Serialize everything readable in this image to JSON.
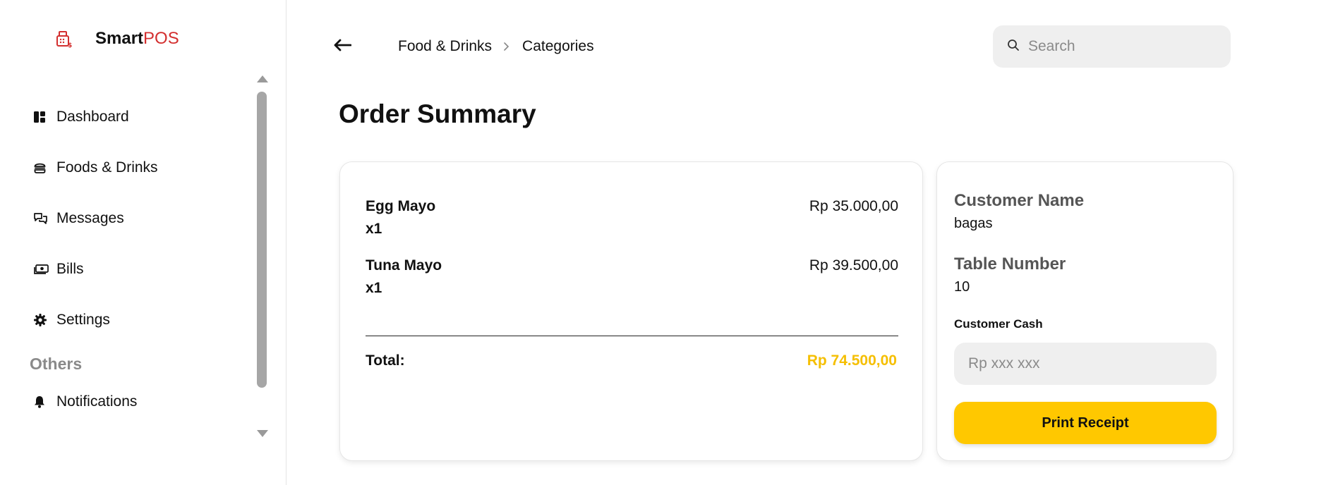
{
  "brand": {
    "name_bold": "Smart",
    "name_accent": "POS",
    "logo_icon": "cash-register-icon",
    "accent_color": "#d32f2f"
  },
  "sidebar": {
    "items": [
      {
        "label": "Dashboard",
        "icon": "dashboard-icon"
      },
      {
        "label": "Foods & Drinks",
        "icon": "burger-icon"
      },
      {
        "label": "Messages",
        "icon": "chat-icon"
      },
      {
        "label": "Bills",
        "icon": "money-icon"
      },
      {
        "label": "Settings",
        "icon": "gear-icon"
      }
    ],
    "section_label": "Others",
    "others_items": [
      {
        "label": "Notifications",
        "icon": "bell-icon"
      }
    ]
  },
  "header": {
    "back_icon": "arrow-left-icon",
    "breadcrumb": [
      "Food & Drinks",
      "Categories"
    ],
    "search": {
      "placeholder": "Search",
      "value": "",
      "icon": "search-icon"
    }
  },
  "page_title": "Order Summary",
  "order": {
    "items": [
      {
        "name": "Egg Mayo",
        "qty": "x1",
        "price": "Rp 35.000,00"
      },
      {
        "name": "Tuna Mayo",
        "qty": "x1",
        "price": "Rp 39.500,00"
      }
    ],
    "total_label": "Total:",
    "total_value": "Rp 74.500,00",
    "total_color": "#f5bf00"
  },
  "customer": {
    "name_label": "Customer Name",
    "name_value": "bagas",
    "table_label": "Table Number",
    "table_value": "10",
    "cash_label": "Customer Cash",
    "cash_placeholder": "Rp xxx xxx",
    "cash_value": "",
    "print_label": "Print Receipt",
    "print_color": "#ffc800"
  }
}
